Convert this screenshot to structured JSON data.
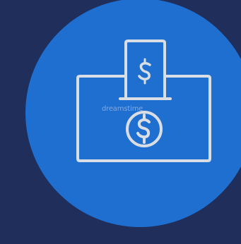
{
  "colors": {
    "background": "#1f2e5a",
    "circle": "#1f6fd1",
    "icon_stroke": "#d9dde4"
  },
  "icons": {
    "illustration": "cash-deposit-icon",
    "banknote": "banknote-icon",
    "coin": "dollar-coin-icon"
  },
  "watermark": {
    "text": "dreamstime"
  }
}
